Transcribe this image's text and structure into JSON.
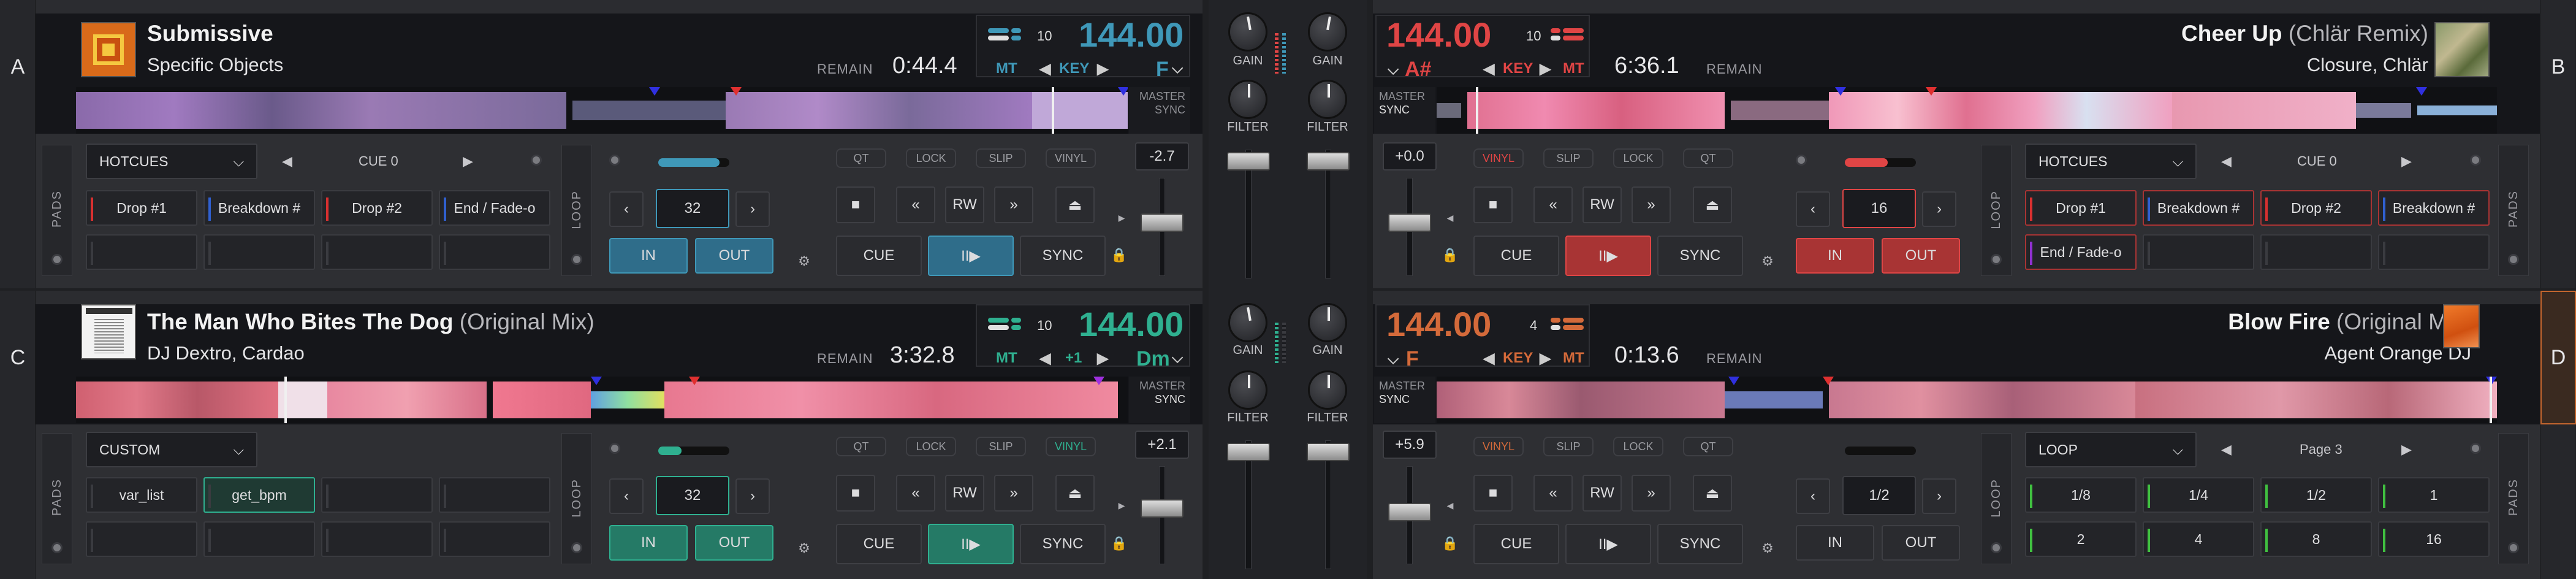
{
  "colors": {
    "deck_blue": "#3f98b8",
    "deck_red": "#e04545",
    "deck_teal": "#2fb090",
    "deck_orange": "#d46a3a",
    "accent_border": "#c4662e"
  },
  "decks": [
    {
      "letter": "A",
      "title": "Submissive",
      "mix": "",
      "artist": "Specific Objects",
      "remain_label": "REMAIN",
      "time": "0:44.4",
      "bpm": "144.00",
      "beat_count": "10",
      "key_mode": "MT",
      "key_label": "KEY",
      "key_value": "F",
      "pitch_offset": "",
      "sync_labels": [
        "MASTER",
        "SYNC"
      ],
      "pads_mode": "HOTCUES",
      "pads_page": "CUE 0",
      "pads": [
        "Drop #1",
        "Breakdown #",
        "Drop #2",
        "End / Fade-o",
        "",
        "",
        "",
        ""
      ],
      "pitch_value": "-2.7",
      "loop_size": "32",
      "pills": [
        "QT",
        "LOCK",
        "SLIP",
        "VINYL"
      ],
      "buttons": {
        "in": "IN",
        "out": "OUT",
        "cue": "CUE",
        "play": "II▶",
        "sync": "SYNC",
        "rw": "RW",
        "loop": "LOOP",
        "pads": "PADS"
      }
    },
    {
      "letter": "B",
      "title": "Cheer Up",
      "mix": "(Chlär Remix)",
      "artist": "Closure, Chlär",
      "remain_label": "REMAIN",
      "time": "6:36.1",
      "bpm": "144.00",
      "beat_count": "10",
      "key_mode": "MT",
      "key_label": "KEY",
      "key_value": "A#",
      "pitch_offset": "",
      "sync_labels": [
        "MASTER",
        "SYNC"
      ],
      "pads_mode": "HOTCUES",
      "pads_page": "CUE 0",
      "pads": [
        "Drop #1",
        "Breakdown #",
        "Drop #2",
        "Breakdown #",
        "End / Fade-o",
        "",
        "",
        ""
      ],
      "pitch_value": "+0.0",
      "loop_size": "16",
      "pills": [
        "VINYL",
        "SLIP",
        "LOCK",
        "QT"
      ],
      "buttons": {
        "in": "IN",
        "out": "OUT",
        "cue": "CUE",
        "play": "II▶",
        "sync": "SYNC",
        "rw": "RW",
        "loop": "LOOP",
        "pads": "PADS"
      }
    },
    {
      "letter": "C",
      "title": "The Man Who Bites The Dog",
      "mix": "(Original Mix)",
      "artist": "DJ Dextro, Cardao",
      "remain_label": "REMAIN",
      "time": "3:32.8",
      "bpm": "144.00",
      "beat_count": "10",
      "key_mode": "MT",
      "key_label": "KEY",
      "key_value": "Dm",
      "pitch_offset": "+1",
      "sync_labels": [
        "MASTER",
        "SYNC"
      ],
      "pads_mode": "CUSTOM",
      "pads_page": "",
      "pads": [
        "var_list",
        "get_bpm",
        "",
        "",
        "",
        "",
        "",
        ""
      ],
      "pitch_value": "+2.1",
      "loop_size": "32",
      "pills": [
        "QT",
        "LOCK",
        "SLIP",
        "VINYL"
      ],
      "buttons": {
        "in": "IN",
        "out": "OUT",
        "cue": "CUE",
        "play": "II▶",
        "sync": "SYNC",
        "rw": "RW",
        "loop": "LOOP",
        "pads": "PADS"
      }
    },
    {
      "letter": "D",
      "title": "Blow Fire",
      "mix": "(Original Mix)",
      "artist": "Agent Orange DJ",
      "remain_label": "REMAIN",
      "time": "0:13.6",
      "bpm": "144.00",
      "beat_count": "4",
      "key_mode": "MT",
      "key_label": "KEY",
      "key_value": "F",
      "pitch_offset": "",
      "sync_labels": [
        "MASTER",
        "SYNC"
      ],
      "pads_mode": "LOOP",
      "pads_page": "Page 3",
      "pads": [
        "1/8",
        "1/4",
        "1/2",
        "1",
        "2",
        "4",
        "8",
        "16"
      ],
      "pitch_value": "+5.9",
      "loop_size": "1/2",
      "pills": [
        "VINYL",
        "SLIP",
        "LOCK",
        "QT"
      ],
      "buttons": {
        "in": "IN",
        "out": "OUT",
        "cue": "CUE",
        "play": "II▶",
        "sync": "SYNC",
        "rw": "RW",
        "loop": "LOOP",
        "pads": "PADS"
      }
    }
  ],
  "mixer": {
    "gain": "GAIN",
    "filter": "FILTER"
  }
}
